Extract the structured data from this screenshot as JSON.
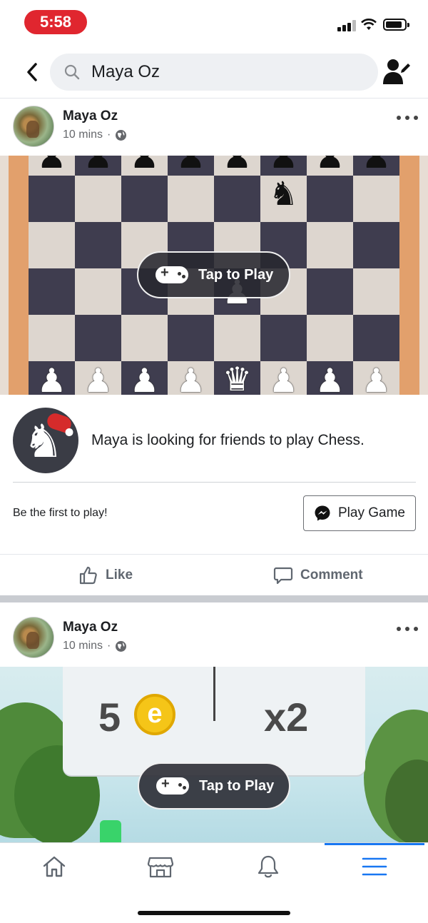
{
  "status_bar": {
    "time": "5:58"
  },
  "search": {
    "query": "Maya Oz"
  },
  "posts": [
    {
      "author": "Maya Oz",
      "time": "10 mins",
      "tap_label": "Tap to Play",
      "game_description": "Maya is looking for friends to play Chess.",
      "cta_text": "Be the first to play!",
      "play_button_label": "Play Game",
      "like_label": "Like",
      "comment_label": "Comment"
    },
    {
      "author": "Maya Oz",
      "time": "10 mins",
      "tap_label": "Tap to Play",
      "score_value": "5",
      "coin_letter": "e",
      "multiplier": "x2"
    }
  ],
  "tabs": [
    "home-icon",
    "marketplace-icon",
    "notifications-icon",
    "menu-icon"
  ],
  "colors": {
    "accent": "#1877f2",
    "time_pill": "#e0262f",
    "board_dark": "#3f3d4f",
    "board_light": "#ddd6cf"
  }
}
